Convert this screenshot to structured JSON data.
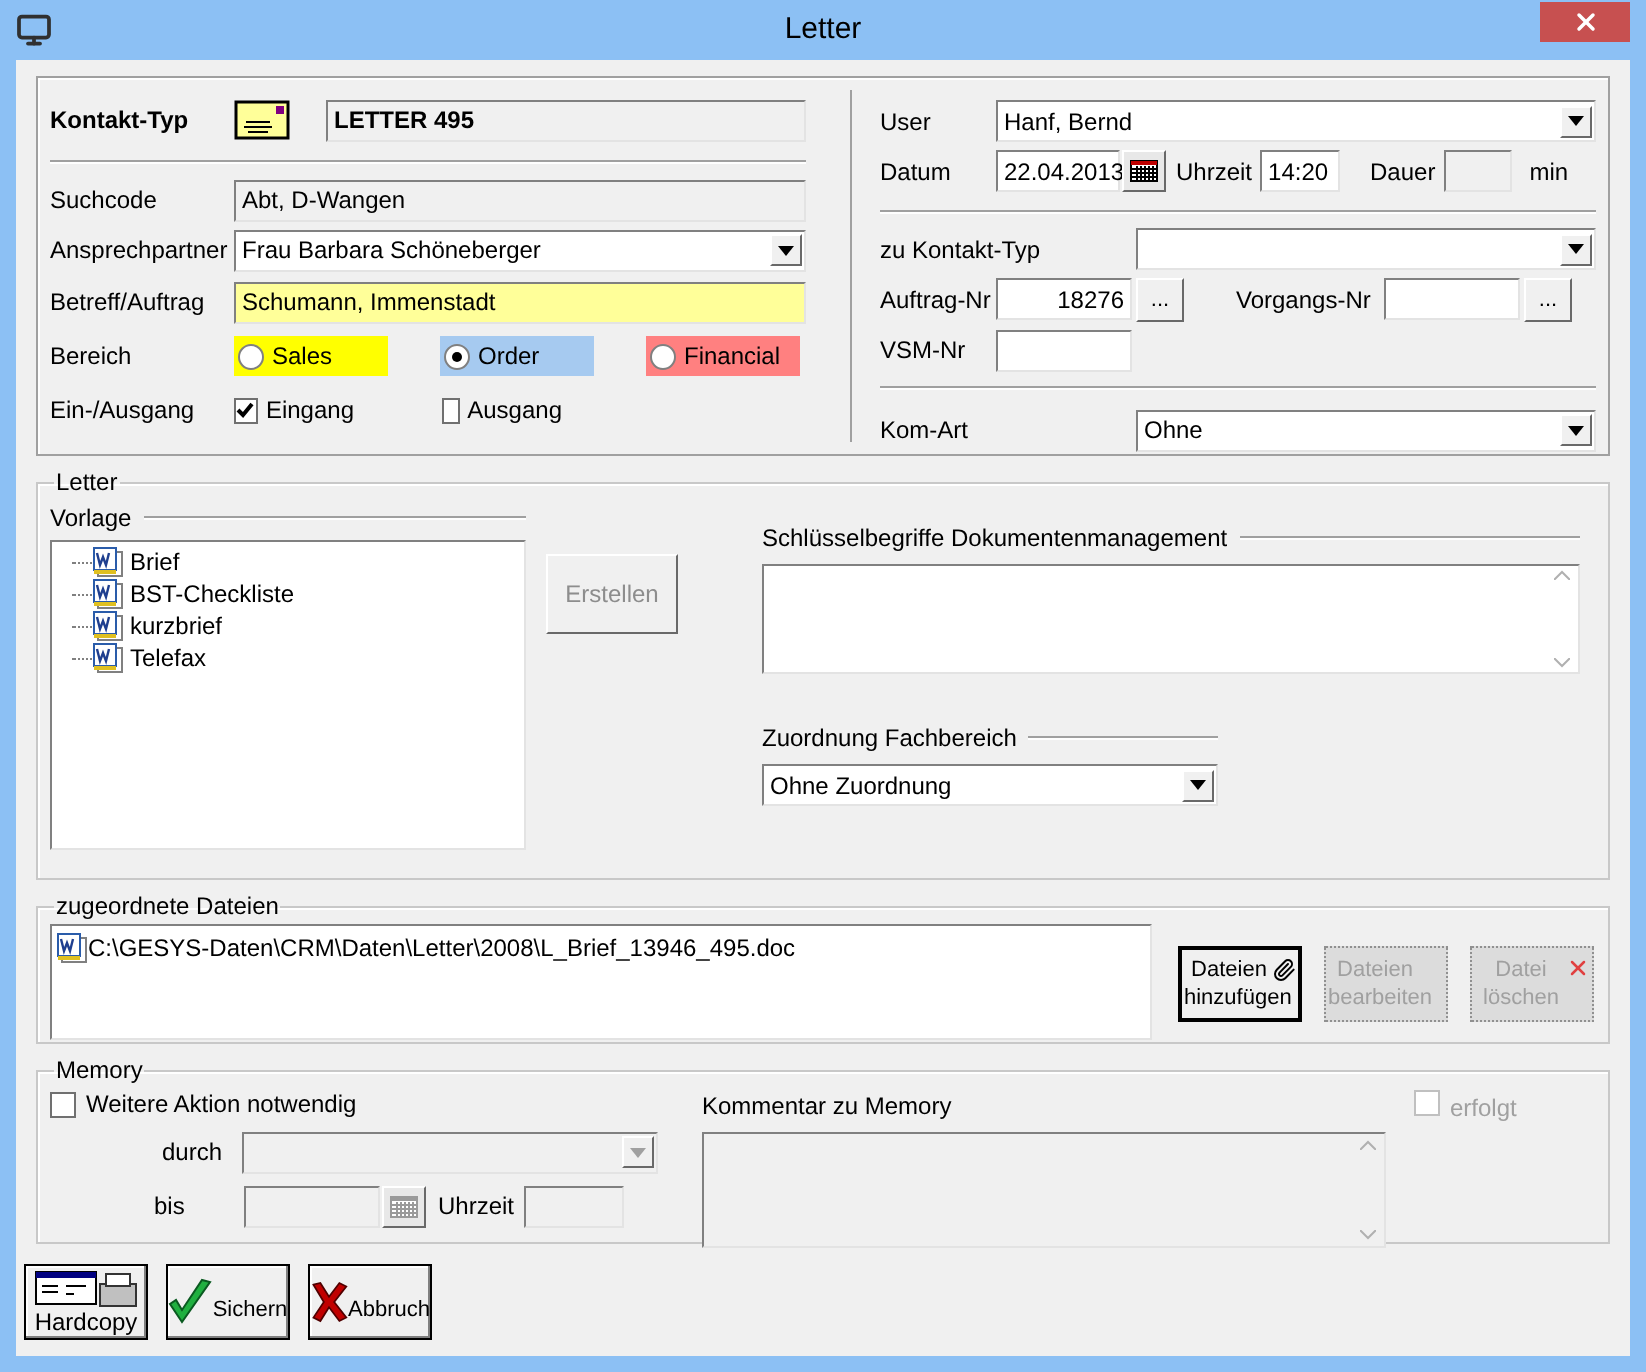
{
  "window": {
    "title": "Letter"
  },
  "contact": {
    "kontakt_typ_label": "Kontakt-Typ",
    "kontakt_typ": "LETTER 495",
    "suchcode_label": "Suchcode",
    "suchcode": "Abt, D-Wangen",
    "ansprechpartner_label": "Ansprechpartner",
    "ansprechpartner": "Frau Barbara Schöneberger",
    "betreff_label": "Betreff/Auftrag",
    "betreff": "Schumann, Immenstadt",
    "bereich_label": "Bereich",
    "bereich": [
      {
        "label": "Sales",
        "selected": false,
        "color": "#ffff00"
      },
      {
        "label": "Order",
        "selected": true,
        "color": "#a6caf0"
      },
      {
        "label": "Financial",
        "selected": false,
        "color": "#ff8080"
      }
    ],
    "richtung_label": "Ein-/Ausgang",
    "richtung": [
      {
        "label": "Eingang",
        "checked": true
      },
      {
        "label": "Ausgang",
        "checked": false
      }
    ]
  },
  "details": {
    "user_label": "User",
    "user": "Hanf, Bernd",
    "datum_label": "Datum",
    "datum": "22.04.2013",
    "uhrzeit_label": "Uhrzeit",
    "uhrzeit": "14:20",
    "dauer_label": "Dauer",
    "dauer_unit": "min",
    "zu_kontakt_typ_label": "zu Kontakt-Typ",
    "auftrag_nr_label": "Auftrag-Nr",
    "auftrag_nr": "18276",
    "auftrag_browse": "...",
    "vorgangs_nr_label": "Vorgangs-Nr",
    "vorgangs_browse": "...",
    "vsm_nr_label": "VSM-Nr",
    "kom_art_label": "Kom-Art",
    "kom_art": "Ohne"
  },
  "letter": {
    "title": "Letter",
    "vorlage_label": "Vorlage",
    "vorlagen": [
      {
        "label": "Brief"
      },
      {
        "label": "BST-Checkliste"
      },
      {
        "label": "kurzbrief"
      },
      {
        "label": "Telefax"
      }
    ],
    "erstellen": {
      "label": "Erstellen",
      "disabled": true
    },
    "schluessel_label": "Schlüsselbegriffe Dokumentenmanagement",
    "zuordnung_label": "Zuordnung Fachbereich",
    "zuordnung": "Ohne Zuordnung"
  },
  "files": {
    "title": "zugeordnete Dateien",
    "items": [
      {
        "path": "C:\\GESYS-Daten\\CRM\\Daten\\Letter\\2008\\L_Brief_13946_495.doc"
      }
    ],
    "buttons": [
      {
        "label": "Dateien hinzufügen",
        "kind": "attach",
        "disabled": false
      },
      {
        "label": "Dateien bearbeiten",
        "kind": "edit",
        "disabled": true
      },
      {
        "label": "Datei löschen",
        "kind": "delete",
        "disabled": true
      }
    ]
  },
  "memory": {
    "title": "Memory",
    "weitere": {
      "label": "Weitere Aktion notwendig",
      "checked": false
    },
    "durch_label": "durch",
    "bis_label": "bis",
    "uhrzeit_label": "Uhrzeit",
    "kommentar_label": "Kommentar zu Memory",
    "erfolgt": {
      "label": "erfolgt",
      "checked": false,
      "disabled": true
    }
  },
  "actions": [
    {
      "label": "Hardcopy",
      "kind": "hardcopy"
    },
    {
      "label": "Sichern",
      "kind": "save"
    },
    {
      "label": "Abbruch",
      "kind": "cancel"
    }
  ]
}
